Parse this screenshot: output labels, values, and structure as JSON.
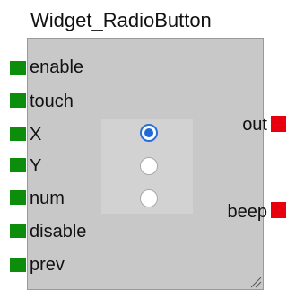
{
  "block": {
    "title": "Widget_RadioButton",
    "inputs": [
      {
        "label": "enable"
      },
      {
        "label": "touch"
      },
      {
        "label": "X"
      },
      {
        "label": "Y"
      },
      {
        "label": "num"
      },
      {
        "label": "disable"
      },
      {
        "label": "prev"
      }
    ],
    "outputs": [
      {
        "label": "out"
      },
      {
        "label": "beep"
      }
    ],
    "radio_buttons": [
      {
        "checked": true
      },
      {
        "checked": false
      },
      {
        "checked": false
      }
    ],
    "colors": {
      "input_pin": "#0c8e0c",
      "output_pin": "#e8000e",
      "body": "#c8c8c8",
      "radio_accent": "#1f6ad8"
    },
    "icons": {
      "resize": "resize-grip-icon"
    }
  }
}
